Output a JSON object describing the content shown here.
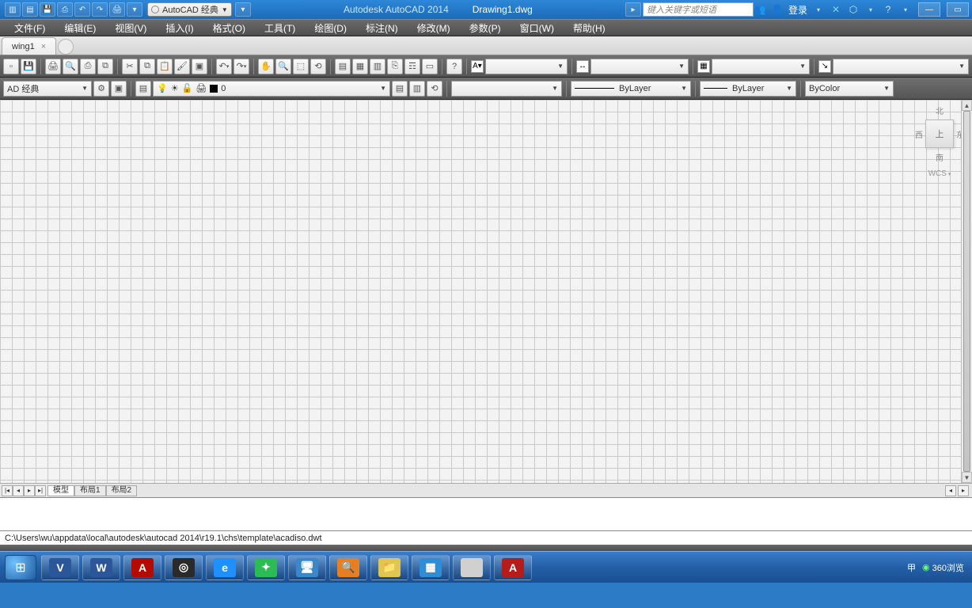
{
  "title": {
    "app": "Autodesk AutoCAD 2014",
    "doc": "Drawing1.dwg"
  },
  "search_placeholder": "键入关键字或短语",
  "login_label": "登录",
  "workspace": "AutoCAD 经典",
  "menubar": [
    "文件(F)",
    "编辑(E)",
    "视图(V)",
    "插入(I)",
    "格式(O)",
    "工具(T)",
    "绘图(D)",
    "标注(N)",
    "修改(M)",
    "参数(P)",
    "窗口(W)",
    "帮助(H)"
  ],
  "doctab": "wing1",
  "workspace2": "AD 经典",
  "layer": {
    "value": "0",
    "light_on": true,
    "frozen": false,
    "locked": false
  },
  "linetype": "ByLayer",
  "lineweight": "ByLayer",
  "plotstyle": "ByColor",
  "viewcube": {
    "north": "北",
    "west": "西",
    "east": "东",
    "face": "上",
    "south": "南",
    "wcs": "WCS"
  },
  "modeltabs": {
    "model": "模型",
    "layout1": "布局1",
    "layout2": "布局2"
  },
  "cmdline_text": "C:\\Users\\wu\\appdata\\local\\autodesk\\autocad 2014\\r19.1\\chs\\template\\acadiso.dwt",
  "tray": {
    "input": "甲",
    "app360": "360浏览"
  },
  "taskbar_apps": [
    {
      "n": "visio",
      "bg": "#2b579a",
      "label": "V"
    },
    {
      "n": "word",
      "bg": "#2b579a",
      "label": "W"
    },
    {
      "n": "acrobat",
      "bg": "#b30b00",
      "label": "A"
    },
    {
      "n": "app1",
      "bg": "#2a2a2a",
      "label": "◎"
    },
    {
      "n": "ie",
      "bg": "#1e90ff",
      "label": "e"
    },
    {
      "n": "wechat",
      "bg": "#2dbb55",
      "label": "✦"
    },
    {
      "n": "remote",
      "bg": "#3c87c8",
      "label": "🖥"
    },
    {
      "n": "search",
      "bg": "#e67e22",
      "label": "🔍"
    },
    {
      "n": "explorer",
      "bg": "#e1c552",
      "label": "📁"
    },
    {
      "n": "mstsc",
      "bg": "#2f8dd6",
      "label": "▦"
    },
    {
      "n": "blank",
      "bg": "#d0d0d0",
      "label": ""
    },
    {
      "n": "autocad",
      "bg": "#b51c1c",
      "label": "A"
    }
  ]
}
